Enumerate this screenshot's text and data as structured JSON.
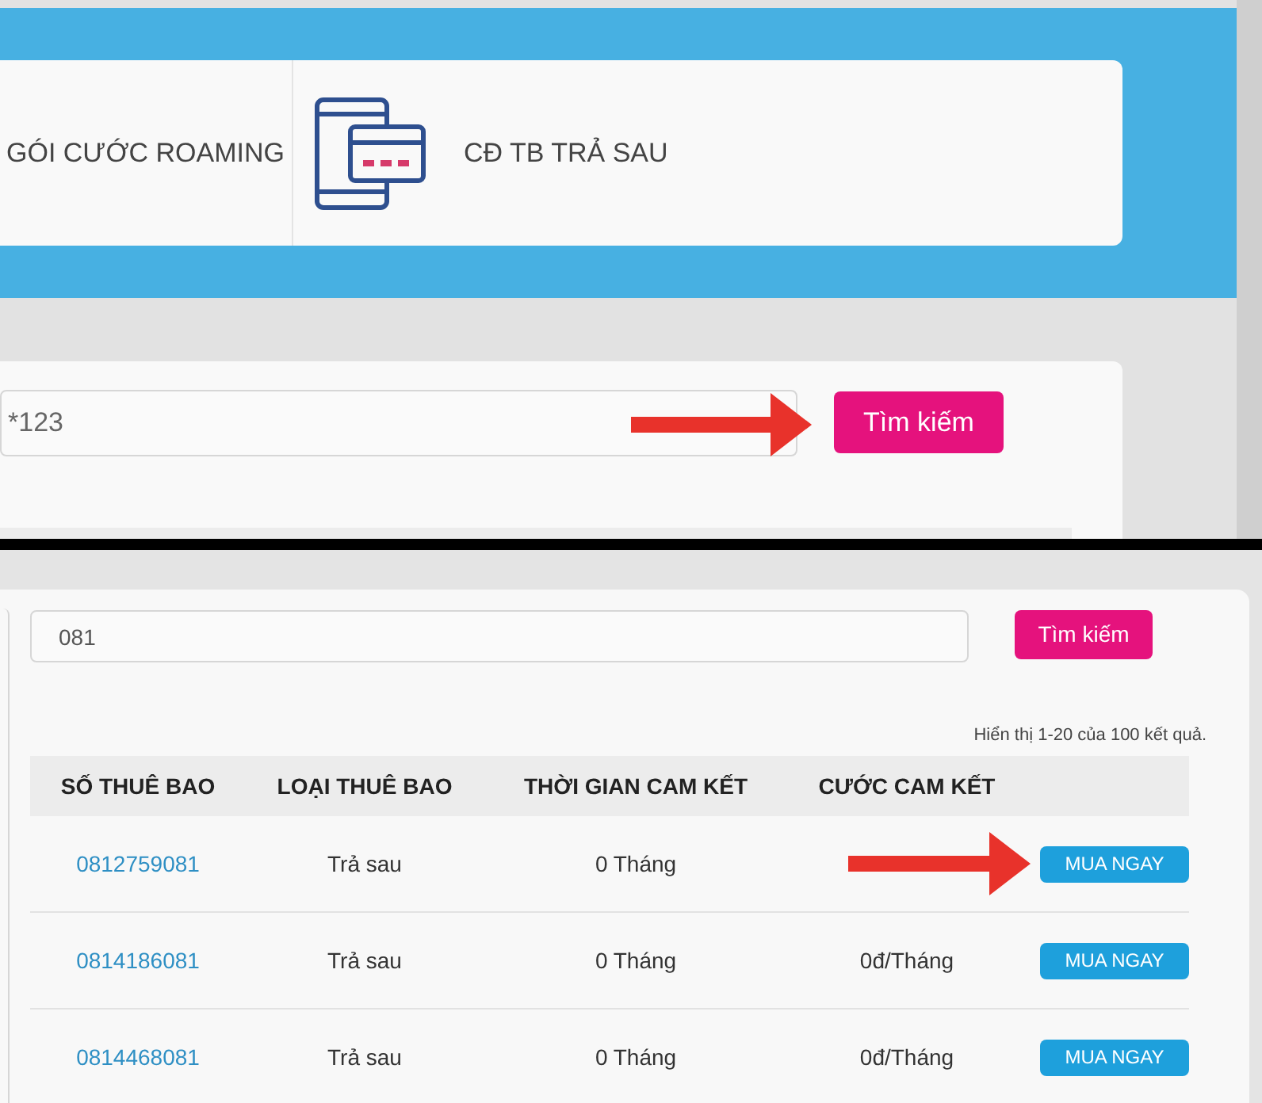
{
  "top_panel": {
    "menu_items": [
      {
        "label": "GÓI CƯỚC ROAMING",
        "icon": false
      },
      {
        "label": "CĐ TB TRẢ SAU",
        "icon": true
      }
    ],
    "search": {
      "value": "*123",
      "button": "Tìm kiếm"
    }
  },
  "bottom_panel": {
    "search": {
      "value": "081",
      "button": "Tìm kiếm"
    },
    "result_summary": "Hiển thị 1-20 của 100 kết quả.",
    "table": {
      "columns": [
        "SỐ THUÊ BAO",
        "LOẠI THUÊ BAO",
        "THỜI GIAN CAM KẾT",
        "CƯỚC CAM KẾT"
      ],
      "rows": [
        {
          "number": "0812759081",
          "type": "Trả sau",
          "term": "0 Tháng",
          "action": "MUA NGAY",
          "arrow": true
        },
        {
          "number": "0814186081",
          "type": "Trả sau",
          "term": "0 Tháng",
          "fee": "0đ/Tháng",
          "action": "MUA NGAY",
          "arrow": false
        },
        {
          "number": "0814468081",
          "type": "Trả sau",
          "term": "0 Tháng",
          "fee": "0đ/Tháng",
          "action": "MUA NGAY",
          "arrow": false
        }
      ]
    }
  }
}
